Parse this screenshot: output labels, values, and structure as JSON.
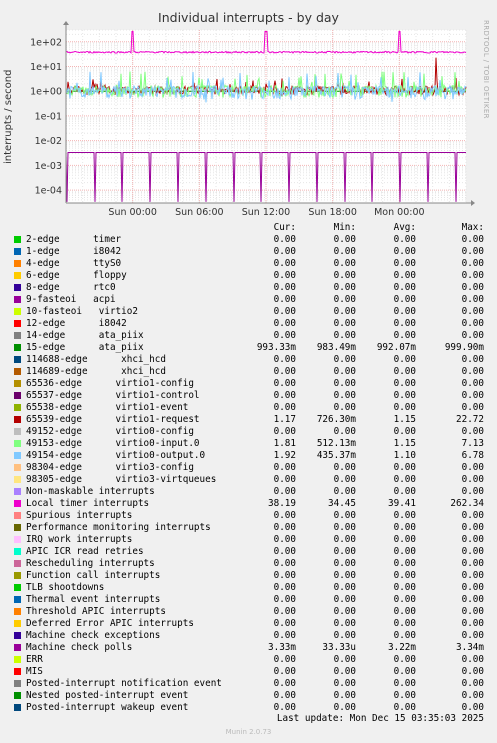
{
  "title": "Individual interrupts - by day",
  "side_label": "RRDTOOL / TOBI OETIKER",
  "ylabel": "interrupts / second",
  "footer": "Munin 2.0.73",
  "last_update": "Last update: Mon Dec 15 03:35:03 2025",
  "columns": {
    "cur": "Cur:",
    "min": "Min:",
    "avg": "Avg:",
    "max": "Max:"
  },
  "chart_data": {
    "type": "line",
    "title": "Individual interrupts - by day",
    "ylabel": "interrupts / second",
    "yscale": "log",
    "ylim": [
      3e-05,
      300
    ],
    "yticks": [
      "1e-04",
      "1e-03",
      "1e-02",
      "1e-01",
      "1e+00",
      "1e+01",
      "1e+02"
    ],
    "xticks": [
      "Sun 00:00",
      "Sun 06:00",
      "Sun 12:00",
      "Sun 18:00",
      "Mon 00:00"
    ],
    "grid": true,
    "legend_placement": "bottom"
  },
  "legend": [
    {
      "name": "2-edge      timer",
      "color": "#00cc00",
      "cur": "0.00",
      "min": "0.00",
      "avg": "0.00",
      "max": "0.00"
    },
    {
      "name": "1-edge      i8042",
      "color": "#0066b3",
      "cur": "0.00",
      "min": "0.00",
      "avg": "0.00",
      "max": "0.00"
    },
    {
      "name": "4-edge      ttyS0",
      "color": "#ff8000",
      "cur": "0.00",
      "min": "0.00",
      "avg": "0.00",
      "max": "0.00"
    },
    {
      "name": "6-edge      floppy",
      "color": "#ffcc00",
      "cur": "0.00",
      "min": "0.00",
      "avg": "0.00",
      "max": "0.00"
    },
    {
      "name": "8-edge      rtc0",
      "color": "#330099",
      "cur": "0.00",
      "min": "0.00",
      "avg": "0.00",
      "max": "0.00"
    },
    {
      "name": "9-fasteoi   acpi",
      "color": "#990099",
      "cur": "0.00",
      "min": "0.00",
      "avg": "0.00",
      "max": "0.00"
    },
    {
      "name": "10-fasteoi   virtio2",
      "color": "#ccff00",
      "cur": "0.00",
      "min": "0.00",
      "avg": "0.00",
      "max": "0.00"
    },
    {
      "name": "12-edge      i8042",
      "color": "#ff0000",
      "cur": "0.00",
      "min": "0.00",
      "avg": "0.00",
      "max": "0.00"
    },
    {
      "name": "14-edge      ata_piix",
      "color": "#808080",
      "cur": "0.00",
      "min": "0.00",
      "avg": "0.00",
      "max": "0.00"
    },
    {
      "name": "15-edge      ata_piix",
      "color": "#008f00",
      "cur": "993.33m",
      "min": "983.49m",
      "avg": "992.07m",
      "max": "999.90m"
    },
    {
      "name": "114688-edge      xhci_hcd",
      "color": "#00487d",
      "cur": "0.00",
      "min": "0.00",
      "avg": "0.00",
      "max": "0.00"
    },
    {
      "name": "114689-edge      xhci_hcd",
      "color": "#b35a00",
      "cur": "0.00",
      "min": "0.00",
      "avg": "0.00",
      "max": "0.00"
    },
    {
      "name": "65536-edge      virtio1-config",
      "color": "#b38f00",
      "cur": "0.00",
      "min": "0.00",
      "avg": "0.00",
      "max": "0.00"
    },
    {
      "name": "65537-edge      virtio1-control",
      "color": "#6b006b",
      "cur": "0.00",
      "min": "0.00",
      "avg": "0.00",
      "max": "0.00"
    },
    {
      "name": "65538-edge      virtio1-event",
      "color": "#8fb300",
      "cur": "0.00",
      "min": "0.00",
      "avg": "0.00",
      "max": "0.00"
    },
    {
      "name": "65539-edge      virtio1-request",
      "color": "#b30000",
      "cur": "1.17",
      "min": "726.30m",
      "avg": "1.15",
      "max": "22.72"
    },
    {
      "name": "49152-edge      virtio0-config",
      "color": "#bebebe",
      "cur": "0.00",
      "min": "0.00",
      "avg": "0.00",
      "max": "0.00"
    },
    {
      "name": "49153-edge      virtio0-input.0",
      "color": "#80ff80",
      "cur": "1.81",
      "min": "512.13m",
      "avg": "1.15",
      "max": "7.13"
    },
    {
      "name": "49154-edge      virtio0-output.0",
      "color": "#80c9ff",
      "cur": "1.92",
      "min": "435.37m",
      "avg": "1.10",
      "max": "6.78"
    },
    {
      "name": "98304-edge      virtio3-config",
      "color": "#ffc080",
      "cur": "0.00",
      "min": "0.00",
      "avg": "0.00",
      "max": "0.00"
    },
    {
      "name": "98305-edge      virtio3-virtqueues",
      "color": "#ffe680",
      "cur": "0.00",
      "min": "0.00",
      "avg": "0.00",
      "max": "0.00"
    },
    {
      "name": "Non-maskable interrupts",
      "color": "#aa80ff",
      "cur": "0.00",
      "min": "0.00",
      "avg": "0.00",
      "max": "0.00"
    },
    {
      "name": "Local timer interrupts",
      "color": "#ee00cc",
      "cur": "38.19",
      "min": "34.45",
      "avg": "39.41",
      "max": "262.34"
    },
    {
      "name": "Spurious interrupts",
      "color": "#ff8080",
      "cur": "0.00",
      "min": "0.00",
      "avg": "0.00",
      "max": "0.00"
    },
    {
      "name": "Performance monitoring interrupts",
      "color": "#666600",
      "cur": "0.00",
      "min": "0.00",
      "avg": "0.00",
      "max": "0.00"
    },
    {
      "name": "IRQ work interrupts",
      "color": "#ffbfff",
      "cur": "0.00",
      "min": "0.00",
      "avg": "0.00",
      "max": "0.00"
    },
    {
      "name": "APIC ICR read retries",
      "color": "#00ffcc",
      "cur": "0.00",
      "min": "0.00",
      "avg": "0.00",
      "max": "0.00"
    },
    {
      "name": "Rescheduling interrupts",
      "color": "#cc6699",
      "cur": "0.00",
      "min": "0.00",
      "avg": "0.00",
      "max": "0.00"
    },
    {
      "name": "Function call interrupts",
      "color": "#999900",
      "cur": "0.00",
      "min": "0.00",
      "avg": "0.00",
      "max": "0.00"
    },
    {
      "name": "TLB shootdowns",
      "color": "#00cc00",
      "cur": "0.00",
      "min": "0.00",
      "avg": "0.00",
      "max": "0.00"
    },
    {
      "name": "Thermal event interrupts",
      "color": "#0066b3",
      "cur": "0.00",
      "min": "0.00",
      "avg": "0.00",
      "max": "0.00"
    },
    {
      "name": "Threshold APIC interrupts",
      "color": "#ff8000",
      "cur": "0.00",
      "min": "0.00",
      "avg": "0.00",
      "max": "0.00"
    },
    {
      "name": "Deferred Error APIC interrupts",
      "color": "#ffcc00",
      "cur": "0.00",
      "min": "0.00",
      "avg": "0.00",
      "max": "0.00"
    },
    {
      "name": "Machine check exceptions",
      "color": "#330099",
      "cur": "0.00",
      "min": "0.00",
      "avg": "0.00",
      "max": "0.00"
    },
    {
      "name": "Machine check polls",
      "color": "#990099",
      "cur": "3.33m",
      "min": "33.33u",
      "avg": "3.22m",
      "max": "3.34m"
    },
    {
      "name": "ERR",
      "color": "#ccff00",
      "cur": "0.00",
      "min": "0.00",
      "avg": "0.00",
      "max": "0.00"
    },
    {
      "name": "MIS",
      "color": "#ff0000",
      "cur": "0.00",
      "min": "0.00",
      "avg": "0.00",
      "max": "0.00"
    },
    {
      "name": "Posted-interrupt notification event",
      "color": "#808080",
      "cur": "0.00",
      "min": "0.00",
      "avg": "0.00",
      "max": "0.00"
    },
    {
      "name": "Nested posted-interrupt event",
      "color": "#008f00",
      "cur": "0.00",
      "min": "0.00",
      "avg": "0.00",
      "max": "0.00"
    },
    {
      "name": "Posted-interrupt wakeup event",
      "color": "#00487d",
      "cur": "0.00",
      "min": "0.00",
      "avg": "0.00",
      "max": "0.00"
    }
  ]
}
